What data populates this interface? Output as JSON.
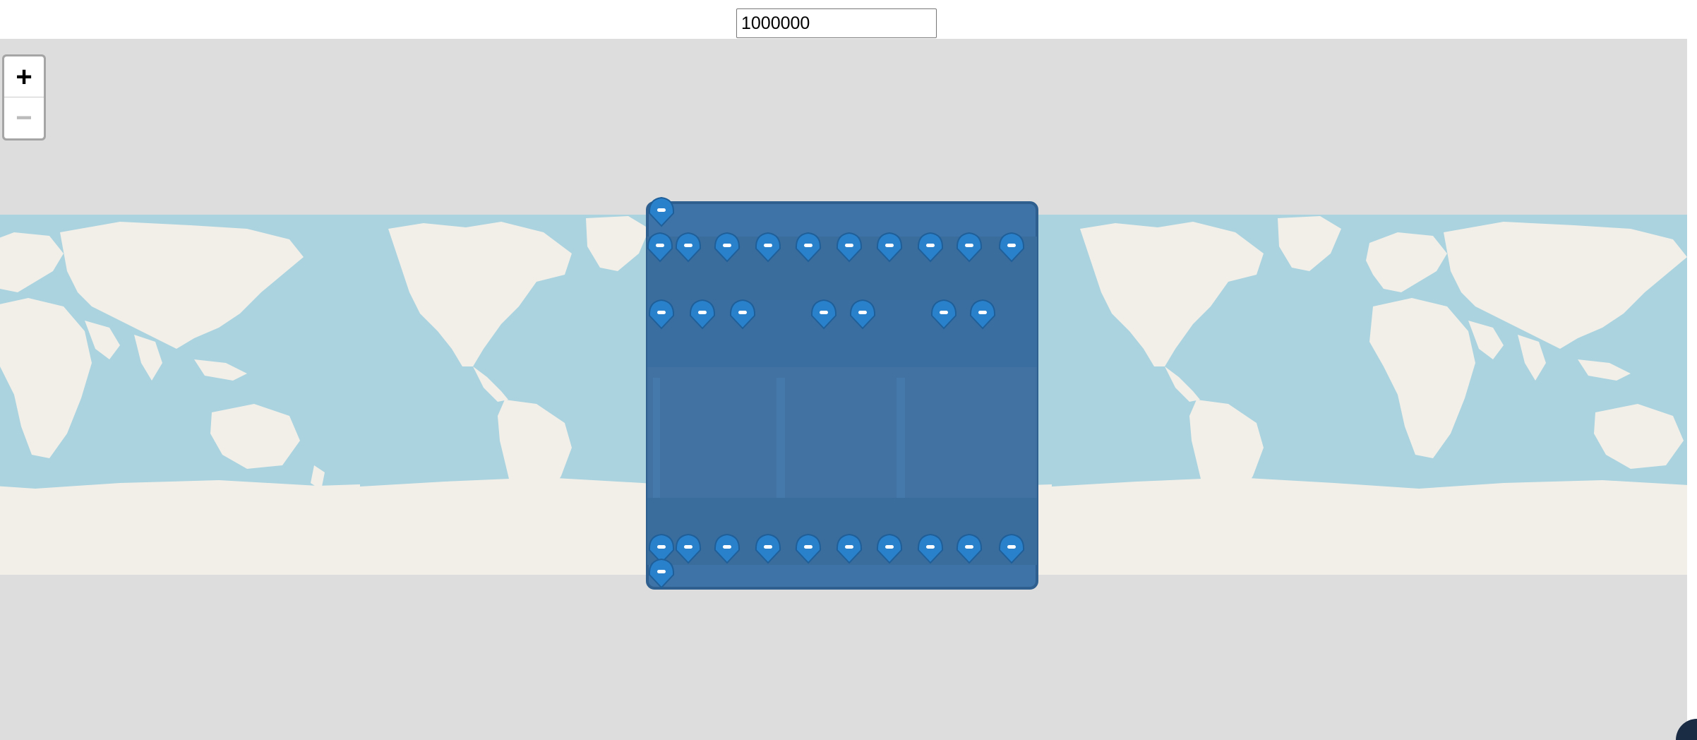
{
  "controls": {
    "marker_count_value": "1000000"
  },
  "map": {
    "zoom_in_label": "+",
    "zoom_out_label": "−",
    "zoom_out_disabled": true,
    "colors": {
      "background": "#dddddd",
      "ocean": "#aad3df",
      "land": "#f2efe9",
      "marker": "#2a81cb",
      "marker_block": "#3d73a6"
    },
    "marker_icon": "map-pin-icon"
  }
}
